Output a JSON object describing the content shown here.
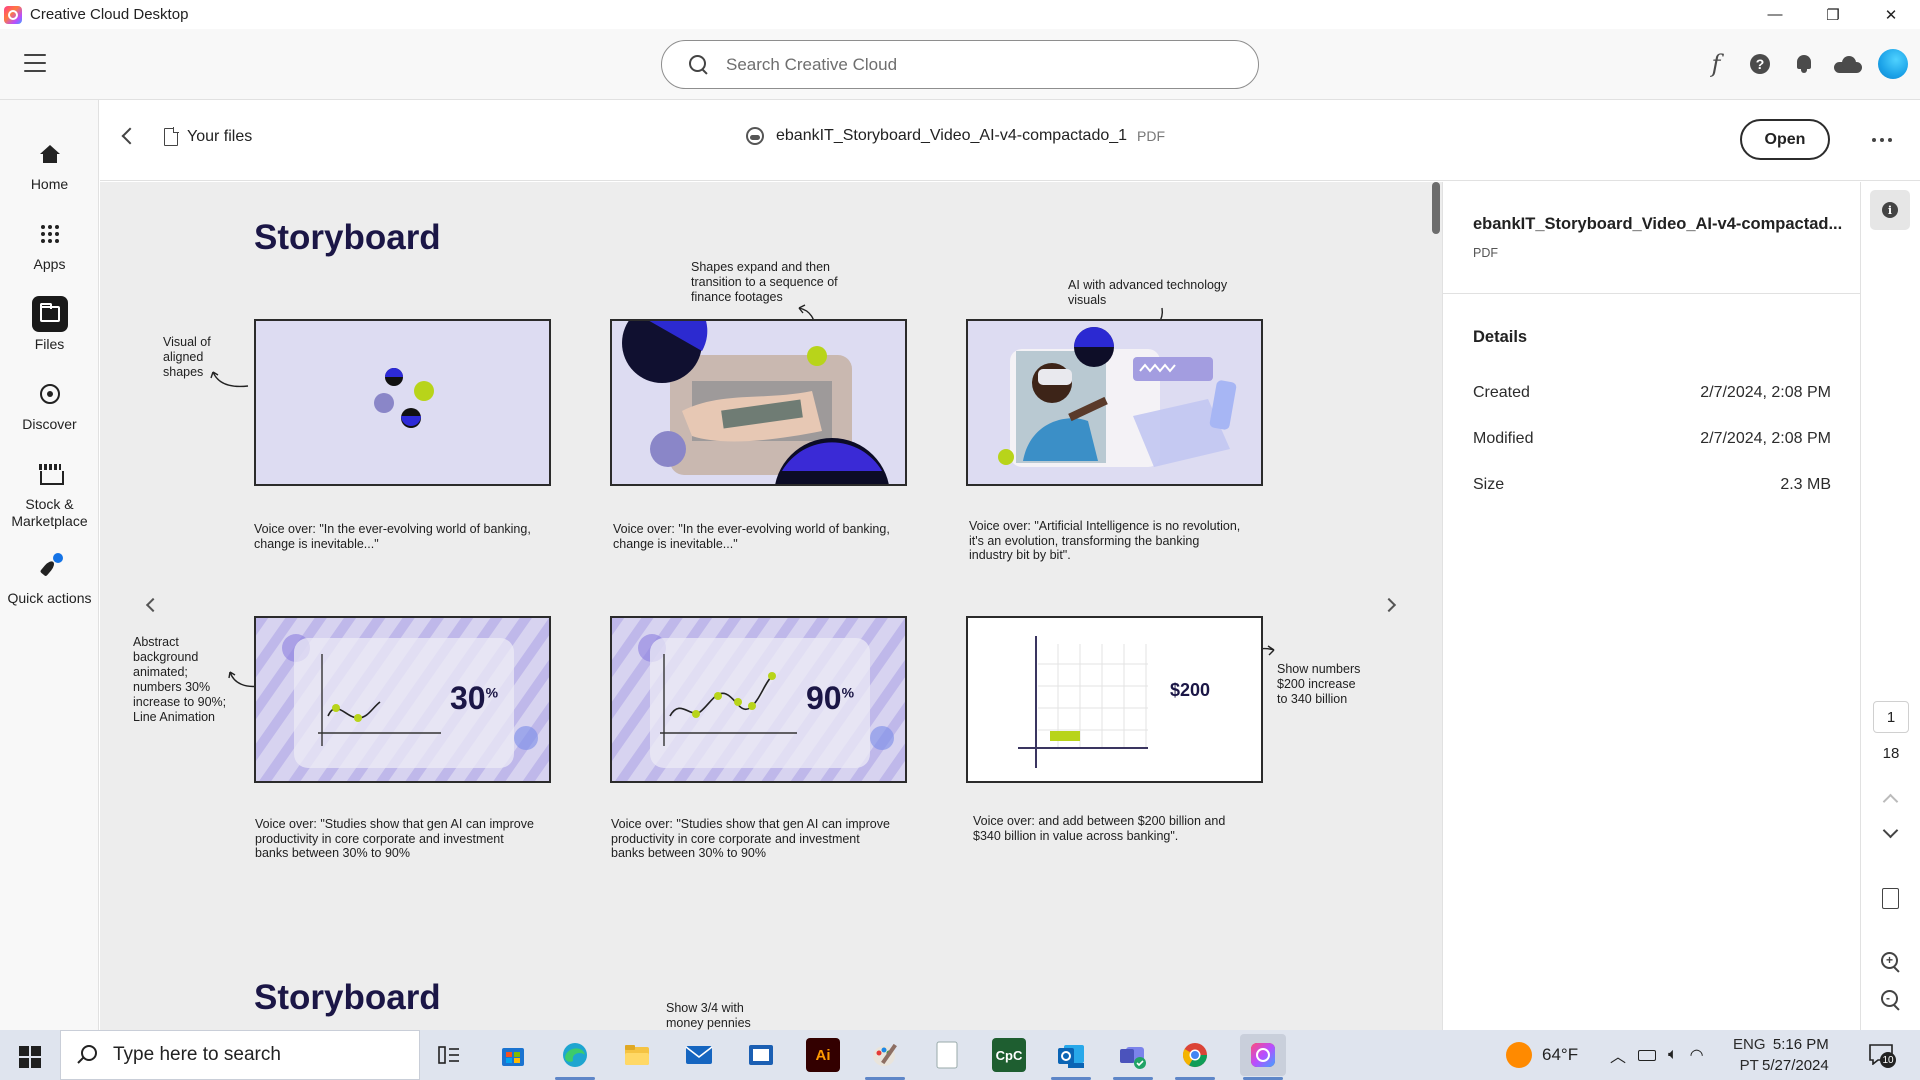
{
  "window": {
    "title": "Creative Cloud Desktop",
    "controls": {
      "minimize": "—",
      "restore": "❐",
      "close": "✕"
    }
  },
  "header": {
    "search_placeholder": "Search Creative Cloud",
    "font_icon": "f",
    "help_icon": "?"
  },
  "nav": {
    "items": [
      {
        "label": "Home",
        "icon": "home-icon"
      },
      {
        "label": "Apps",
        "icon": "apps-grid-icon"
      },
      {
        "label": "Files",
        "icon": "folder-icon",
        "active": true
      },
      {
        "label": "Discover",
        "icon": "compass-icon"
      },
      {
        "label": "Stock & Marketplace",
        "icon": "stock-icon"
      },
      {
        "label": "Quick actions",
        "icon": "rocket-icon"
      }
    ]
  },
  "filebar": {
    "breadcrumb": "Your files",
    "file_name": "ebankIT_Storyboard_Video_AI-v4-compactado_1",
    "file_type": "PDF",
    "open_label": "Open"
  },
  "document": {
    "heading": "Storyboard",
    "heading_next": "Storyboard",
    "notes": {
      "row1_left": [
        "Visual of",
        "aligned",
        "shapes"
      ],
      "row1_mid": [
        "Shapes expand and then",
        "transition to a sequence of",
        "finance footages"
      ],
      "row1_right": [
        "AI with advanced technology",
        "visuals"
      ],
      "row2_left": [
        "Abstract",
        "background",
        "animated;",
        "numbers 30%",
        "increase to 90%;",
        "Line Animation"
      ],
      "row2_right": [
        "Show numbers",
        "$200 increase",
        "to 340 billion"
      ],
      "next_mid": [
        "Show 3/4 with",
        "money pennies"
      ]
    },
    "voiceovers": {
      "r1c1": [
        "Voice over: \"In the ever-evolving world of banking,",
        "change is inevitable...\""
      ],
      "r1c2": [
        "Voice over: \"In the ever-evolving world of banking,",
        "change is inevitable...\""
      ],
      "r1c3": [
        "Voice over: \"Artificial Intelligence is no revolution,",
        "it's an evolution, transforming the banking",
        "industry bit by bit\"."
      ],
      "r2c1": [
        "Voice over: \"Studies show that gen AI can improve",
        "productivity in core corporate and investment",
        "banks between 30% to 90%"
      ],
      "r2c2": [
        "Voice over: \"Studies show that gen AI can improve",
        "productivity in core corporate and investment",
        "banks between 30% to 90%"
      ],
      "r2c3": [
        "Voice over: and add between $200 billion and",
        "$340 billion in value across banking\"."
      ]
    },
    "frames": {
      "stat1": "30",
      "stat1_sup": "%",
      "stat2": "90",
      "stat2_sup": "%",
      "stat3": "$200"
    },
    "colors": {
      "navy": "#1b1646",
      "lime": "#b8d41a",
      "frame_bg": "#dddcf2",
      "purple": "#8a86c8"
    }
  },
  "info": {
    "file_name": "ebankIT_Storyboard_Video_AI-v4-compactad...",
    "file_type": "PDF",
    "details_title": "Details",
    "rows": [
      {
        "label": "Created",
        "value": "2/7/2024, 2:08 PM"
      },
      {
        "label": "Modified",
        "value": "2/7/2024, 2:08 PM"
      },
      {
        "label": "Size",
        "value": "2.3 MB"
      }
    ]
  },
  "rail": {
    "current_page": "1",
    "total_pages": "18"
  },
  "taskbar": {
    "search_text": "Type here to search",
    "apps": [
      "task-view-icon",
      "store-icon",
      "edge-icon",
      "explorer-icon",
      "mail-icon",
      "news-icon",
      "illustrator-icon",
      "paint-icon",
      "notepad-icon",
      "cpc-icon",
      "outlook-icon",
      "teams-icon",
      "chrome-icon",
      "creative-cloud-icon"
    ],
    "illustrator_label": "Ai",
    "cpc_label": "CpC",
    "weather": "64°F",
    "lang": "ENG",
    "lang_sub": "PT",
    "time": "5:16 PM",
    "date": "5/27/2024",
    "notifications": "10"
  }
}
